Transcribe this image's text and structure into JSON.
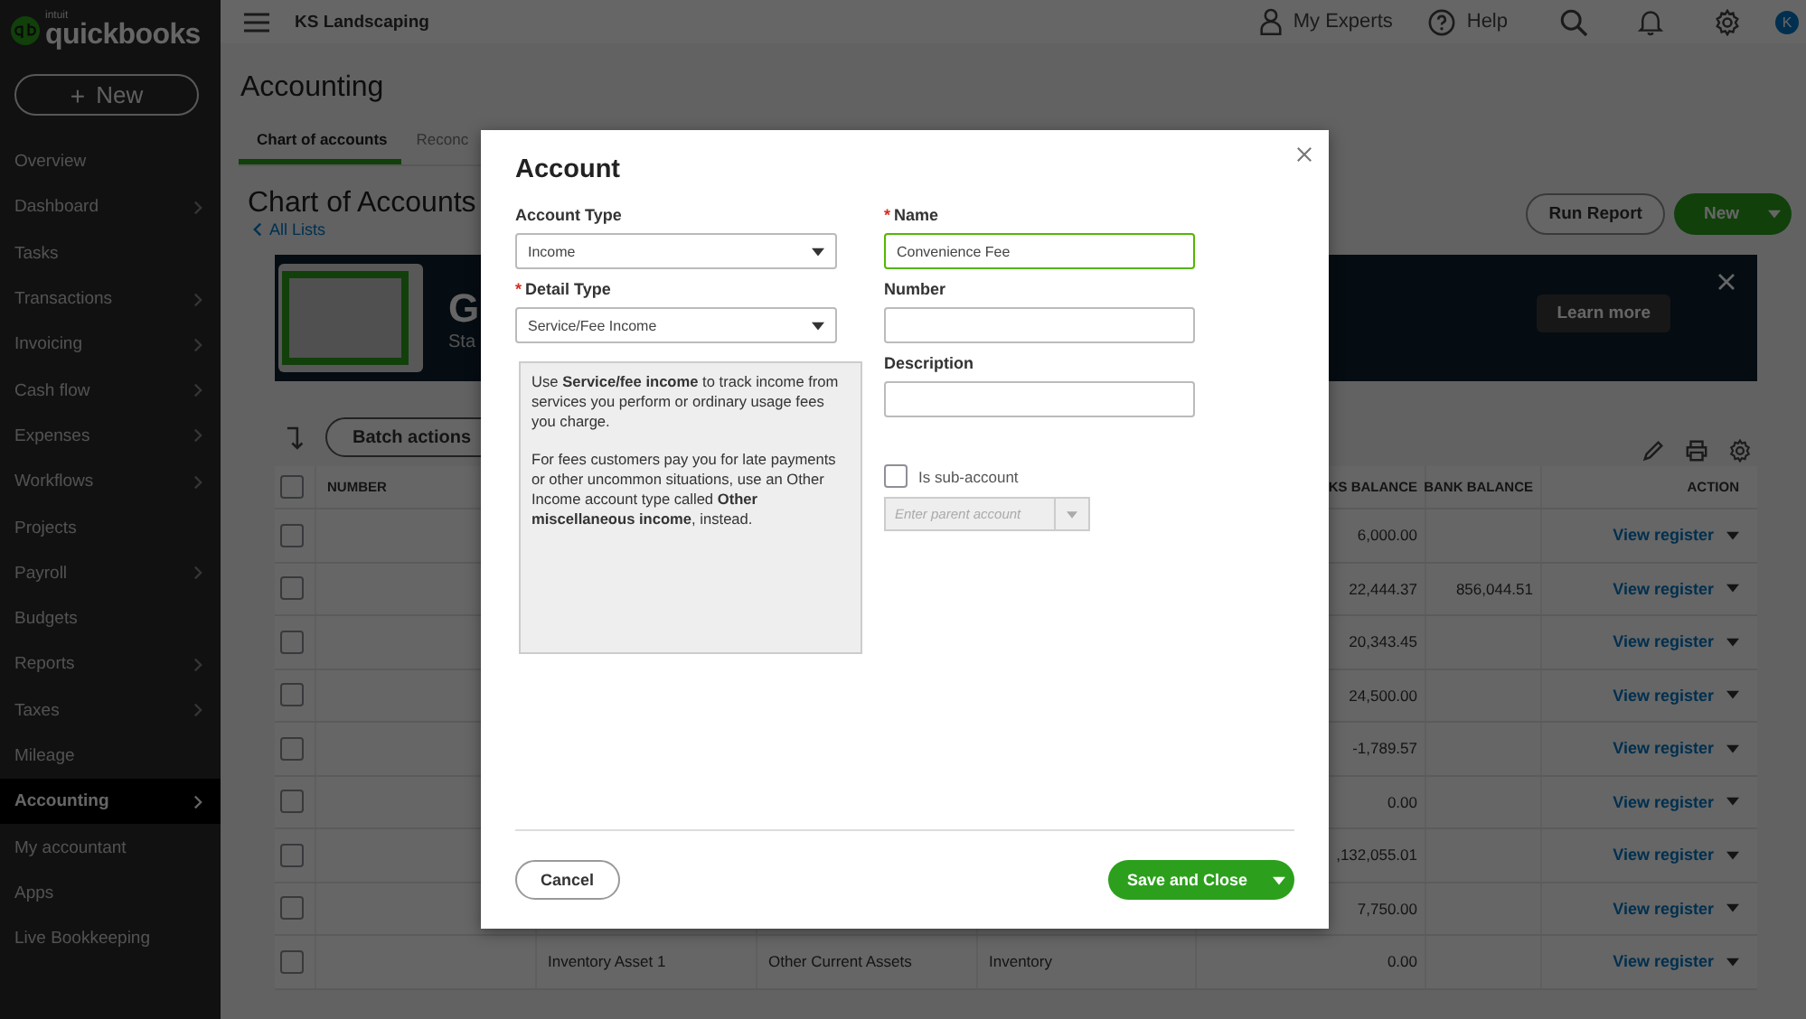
{
  "sidebar": {
    "logo_small": "intuit",
    "logo": "quickbooks",
    "new_button": "New",
    "new_button_icon": "+",
    "items": [
      {
        "label": "Overview",
        "selected": false,
        "has_submenu": false
      },
      {
        "label": "Dashboard",
        "selected": false,
        "has_submenu": true
      },
      {
        "label": "Tasks",
        "selected": false,
        "has_submenu": false
      },
      {
        "label": "Transactions",
        "selected": false,
        "has_submenu": true
      },
      {
        "label": "Invoicing",
        "selected": false,
        "has_submenu": true
      },
      {
        "label": "Cash flow",
        "selected": false,
        "has_submenu": true
      },
      {
        "label": "Expenses",
        "selected": false,
        "has_submenu": true
      },
      {
        "label": "Workflows",
        "selected": false,
        "has_submenu": true
      },
      {
        "label": "Projects",
        "selected": false,
        "has_submenu": false
      },
      {
        "label": "Payroll",
        "selected": false,
        "has_submenu": true
      },
      {
        "label": "Budgets",
        "selected": false,
        "has_submenu": false
      },
      {
        "label": "Reports",
        "selected": false,
        "has_submenu": true
      },
      {
        "label": "Taxes",
        "selected": false,
        "has_submenu": true
      },
      {
        "label": "Mileage",
        "selected": false,
        "has_submenu": false
      },
      {
        "label": "Accounting",
        "selected": true,
        "has_submenu": true
      },
      {
        "label": "My accountant",
        "selected": false,
        "has_submenu": false
      },
      {
        "label": "Apps",
        "selected": false,
        "has_submenu": false
      },
      {
        "label": "Live Bookkeeping",
        "selected": false,
        "has_submenu": false
      }
    ]
  },
  "top_bar": {
    "company": "KS Landscaping",
    "my_experts": "My Experts",
    "help": "Help",
    "avatar": "K"
  },
  "page": {
    "title": "Accounting",
    "tabs": [
      {
        "label": "Chart of accounts",
        "selected": true
      },
      {
        "label": "Reconc",
        "selected": false
      }
    ],
    "heading": "Chart of Accounts",
    "back_link": "All Lists",
    "run_report": "Run Report",
    "new_button": "New",
    "banner": {
      "title": "G",
      "subtitle": "Sta",
      "button": "Learn more"
    },
    "batch_actions": "Batch actions",
    "table": {
      "select_all_checked": false,
      "headers": {
        "number": "NUMBER",
        "balance": "KS BALANCE",
        "bank_balance": "BANK BALANCE",
        "action": "ACTION"
      },
      "rows": [
        {
          "checked": false,
          "balance": "6,000.00",
          "action": "View register"
        },
        {
          "checked": false,
          "balance": "22,444.37",
          "bank_balance": "856,044.51",
          "action": "View register"
        },
        {
          "checked": false,
          "balance": "20,343.45",
          "action": "View register"
        },
        {
          "checked": false,
          "balance": "24,500.00",
          "action": "View register"
        },
        {
          "checked": false,
          "balance": "-1,789.57",
          "action": "View register"
        },
        {
          "checked": false,
          "balance": "0.00",
          "action": "View register"
        },
        {
          "checked": false,
          "balance": ",132,055.01",
          "action": "View register"
        },
        {
          "checked": false,
          "balance": "7,750.00",
          "action": "View register"
        },
        {
          "checked": false,
          "name": "Inventory Asset 1",
          "type": "Other Current Assets",
          "detail_type": "Inventory",
          "balance": "0.00",
          "action": "View register"
        }
      ]
    }
  },
  "dialog": {
    "title": "Account",
    "required_mark": "*",
    "account_type": {
      "label": "Account Type",
      "required": false,
      "value": "Income"
    },
    "detail_type": {
      "label": "Detail Type",
      "required": true,
      "value": "Service/Fee Income"
    },
    "info": [
      "Use **Service/fee income** to track income from services you perform or ordinary usage fees you charge.",
      "For fees customers pay you for late payments or other uncommon situations, use an Other Income account type called **Other miscellaneous income**, instead."
    ],
    "name": {
      "label": "Name",
      "required": true,
      "value": "Convenience Fee",
      "focused": true
    },
    "number": {
      "label": "Number",
      "required": false
    },
    "description": {
      "label": "Description",
      "required": false
    },
    "sub_account": {
      "label": "Is sub-account",
      "checked": false
    },
    "parent_account": {
      "placeholder": "Enter parent account",
      "disabled": true
    },
    "cancel": "Cancel",
    "save": "Save and Close"
  }
}
